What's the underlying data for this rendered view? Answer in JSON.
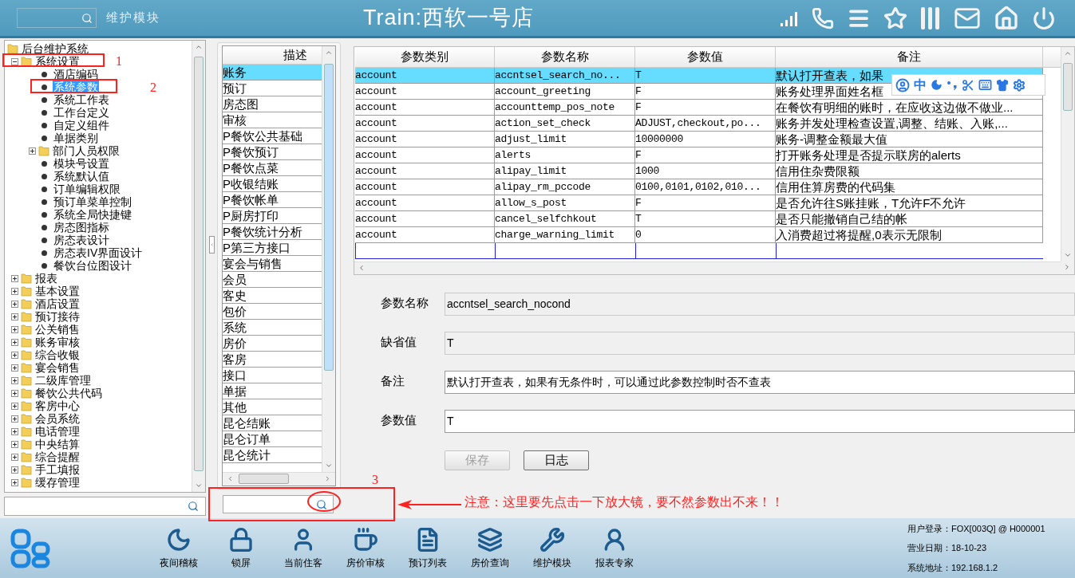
{
  "header": {
    "module": "维护模块",
    "title": "Train:西软一号店"
  },
  "tree": {
    "label": "后台维护系统",
    "kind": "folder",
    "children": [
      {
        "label": "系统设置",
        "kind": "folder",
        "expanded": true,
        "children": [
          {
            "label": "酒店编码",
            "kind": "leaf",
            "selected": false
          },
          {
            "label": "系统参数",
            "kind": "leaf",
            "selected": true
          },
          {
            "label": "系统工作表",
            "kind": "leaf",
            "selected": false
          },
          {
            "label": "工作台定义",
            "kind": "leaf",
            "selected": false
          },
          {
            "label": "自定义组件",
            "kind": "leaf",
            "selected": false
          },
          {
            "label": "单据类别",
            "kind": "leaf",
            "selected": false
          },
          {
            "label": "部门人员权限",
            "kind": "folder",
            "expanded": false
          },
          {
            "label": "模块号设置",
            "kind": "leaf",
            "selected": false
          },
          {
            "label": "系统默认值",
            "kind": "leaf",
            "selected": false
          },
          {
            "label": "订单编辑权限",
            "kind": "leaf",
            "selected": false
          },
          {
            "label": "预订单菜单控制",
            "kind": "leaf",
            "selected": false
          },
          {
            "label": "系统全局快捷键",
            "kind": "leaf",
            "selected": false
          },
          {
            "label": "房态图指标",
            "kind": "leaf",
            "selected": false
          },
          {
            "label": "房态表设计",
            "kind": "leaf",
            "selected": false
          },
          {
            "label": "房态表IV界面设计",
            "kind": "leaf",
            "selected": false
          },
          {
            "label": "餐饮台位图设计",
            "kind": "leaf",
            "selected": false
          }
        ]
      },
      {
        "label": "报表",
        "kind": "folder",
        "expanded": false
      },
      {
        "label": "基本设置",
        "kind": "folder",
        "expanded": false
      },
      {
        "label": "酒店设置",
        "kind": "folder",
        "expanded": false
      },
      {
        "label": "预订接待",
        "kind": "folder",
        "expanded": false
      },
      {
        "label": "公关销售",
        "kind": "folder",
        "expanded": false
      },
      {
        "label": "账务审核",
        "kind": "folder",
        "expanded": false
      },
      {
        "label": "综合收银",
        "kind": "folder",
        "expanded": false
      },
      {
        "label": "宴会销售",
        "kind": "folder",
        "expanded": false
      },
      {
        "label": "二级库管理",
        "kind": "folder",
        "expanded": false
      },
      {
        "label": "餐饮公共代码",
        "kind": "folder",
        "expanded": false
      },
      {
        "label": "客房中心",
        "kind": "folder",
        "expanded": false
      },
      {
        "label": "会员系统",
        "kind": "folder",
        "expanded": false
      },
      {
        "label": "电话管理",
        "kind": "folder",
        "expanded": false
      },
      {
        "label": "中央结算",
        "kind": "folder",
        "expanded": false
      },
      {
        "label": "综合提醒",
        "kind": "folder",
        "expanded": false
      },
      {
        "label": "手工填报",
        "kind": "folder",
        "expanded": false
      },
      {
        "label": "缓存管理",
        "kind": "folder",
        "expanded": false
      }
    ]
  },
  "desc_list": {
    "header": "描述",
    "items": [
      {
        "label": "账务",
        "selected": true
      },
      {
        "label": "预订",
        "selected": false
      },
      {
        "label": "房态图",
        "selected": false
      },
      {
        "label": "审核",
        "selected": false
      },
      {
        "label": "P餐饮公共基础",
        "selected": false
      },
      {
        "label": "P餐饮预订",
        "selected": false
      },
      {
        "label": "P餐饮点菜",
        "selected": false
      },
      {
        "label": "P收银结账",
        "selected": false
      },
      {
        "label": "P餐饮帐单",
        "selected": false
      },
      {
        "label": "P厨房打印",
        "selected": false
      },
      {
        "label": "P餐饮统计分析",
        "selected": false
      },
      {
        "label": "P第三方接口",
        "selected": false
      },
      {
        "label": "宴会与销售",
        "selected": false
      },
      {
        "label": "会员",
        "selected": false
      },
      {
        "label": "客史",
        "selected": false
      },
      {
        "label": "包价",
        "selected": false
      },
      {
        "label": "系统",
        "selected": false
      },
      {
        "label": "房价",
        "selected": false
      },
      {
        "label": "客房",
        "selected": false
      },
      {
        "label": "接口",
        "selected": false
      },
      {
        "label": "单据",
        "selected": false
      },
      {
        "label": "其他",
        "selected": false
      },
      {
        "label": "昆仑结账",
        "selected": false
      },
      {
        "label": "昆仑订单",
        "selected": false
      },
      {
        "label": "昆仑统计",
        "selected": false
      }
    ]
  },
  "table": {
    "columns": [
      "参数类别",
      "参数名称",
      "参数值",
      "备注"
    ],
    "rows": [
      {
        "cells": [
          "account",
          "accntsel_search_no...",
          "T",
          "默认打开查表，如果"
        ],
        "selected": true
      },
      {
        "cells": [
          "account",
          "account_greeting",
          "F",
          "账务处理界面姓名框"
        ],
        "selected": false
      },
      {
        "cells": [
          "account",
          "accounttemp_pos_note",
          "F",
          "在餐饮有明细的账时，在应收这边做不做业..."
        ],
        "selected": false
      },
      {
        "cells": [
          "account",
          "action_set_check",
          "ADJUST,checkout,po...",
          "账务并发处理检查设置,调整、结账、入账,..."
        ],
        "selected": false
      },
      {
        "cells": [
          "account",
          "adjust_limit",
          "10000000",
          "账务-调整金额最大值"
        ],
        "selected": false
      },
      {
        "cells": [
          "account",
          "alerts",
          "F",
          "打开账务处理是否提示联房的alerts"
        ],
        "selected": false
      },
      {
        "cells": [
          "account",
          "alipay_limit",
          "1000",
          "信用住杂费限额"
        ],
        "selected": false
      },
      {
        "cells": [
          "account",
          "alipay_rm_pccode",
          "0100,0101,0102,010...",
          "信用住算房费的代码集"
        ],
        "selected": false
      },
      {
        "cells": [
          "account",
          "allow_s_post",
          "F",
          "是否允许往S账挂账，T允许F不允许"
        ],
        "selected": false
      },
      {
        "cells": [
          "account",
          "cancel_selfchkout",
          "T",
          "是否只能撤销自己结的帐"
        ],
        "selected": false
      },
      {
        "cells": [
          "account",
          "charge_warning_limit",
          "0",
          "入消费超过将提醒,0表示无限制"
        ],
        "selected": false
      }
    ]
  },
  "ime_toolbar": {
    "label": "中"
  },
  "form": {
    "fields": [
      {
        "label": "参数名称",
        "value": "accntsel_search_nocond",
        "disabled": true
      },
      {
        "label": "缺省值",
        "value": "T",
        "disabled": true
      },
      {
        "label": "备注",
        "value": "默认打开查表，如果有无条件时，可以通过此参数控制时否不查表",
        "disabled": false
      },
      {
        "label": "参数值",
        "value": "T",
        "disabled": false
      }
    ],
    "buttons": [
      {
        "label": "保存",
        "disabled": true
      },
      {
        "label": "日志",
        "disabled": false
      }
    ]
  },
  "annotations": {
    "marks": [
      "1",
      "2",
      "3"
    ],
    "note": "注意：这里要先点击一下放大镜，要不然参数出不来！！"
  },
  "footer": {
    "items": [
      {
        "label": "夜间稽核"
      },
      {
        "label": "锁屏"
      },
      {
        "label": "当前住客"
      },
      {
        "label": "房价审核"
      },
      {
        "label": "预订列表"
      },
      {
        "label": "房价查询"
      },
      {
        "label": "维护模块"
      },
      {
        "label": "报表专家"
      }
    ],
    "info": [
      "用户登录：FOX[003Q] @ H000001",
      "营业日期：18-10-23",
      "系统地址：192.168.1.2"
    ]
  }
}
